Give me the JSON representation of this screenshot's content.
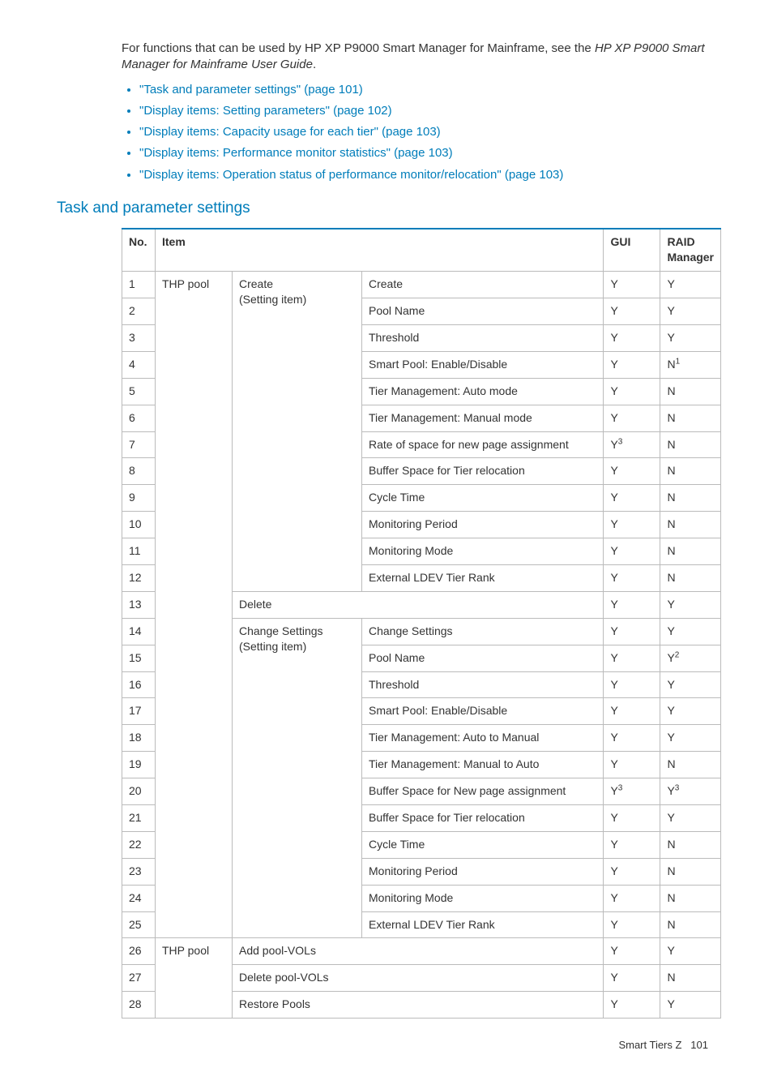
{
  "intro": {
    "text1": "For functions that can be used by HP XP P9000 Smart Manager for Mainframe, see the ",
    "italic": "HP XP P9000 Smart Manager for Mainframe User Guide",
    "text2": "."
  },
  "toc": [
    "\"Task and parameter settings\" (page 101)",
    "\"Display items: Setting parameters\" (page 102)",
    "\"Display items: Capacity usage for each tier\" (page 103)",
    "\"Display items: Performance monitor statistics\" (page 103)",
    "\"Display items: Operation status of performance monitor/relocation\" (page 103)"
  ],
  "section_heading": "Task and parameter settings",
  "table": {
    "headers": {
      "no": "No.",
      "item": "Item",
      "gui": "GUI",
      "raid": "RAID Manager"
    },
    "rows": [
      {
        "no": "1",
        "item1": "THP pool",
        "item2": "Create",
        "item2b": "(Setting item)",
        "item3": "Create",
        "gui": "Y",
        "gui_sup": "",
        "raid": "Y",
        "raid_sup": ""
      },
      {
        "no": "2",
        "item1": "",
        "item2": "",
        "item2b": "",
        "item3": "Pool Name",
        "gui": "Y",
        "gui_sup": "",
        "raid": "Y",
        "raid_sup": ""
      },
      {
        "no": "3",
        "item1": "",
        "item2": "",
        "item2b": "",
        "item3": "Threshold",
        "gui": "Y",
        "gui_sup": "",
        "raid": "Y",
        "raid_sup": ""
      },
      {
        "no": "4",
        "item1": "",
        "item2": "",
        "item2b": "",
        "item3": "Smart Pool: Enable/Disable",
        "gui": "Y",
        "gui_sup": "",
        "raid": "N",
        "raid_sup": "1"
      },
      {
        "no": "5",
        "item1": "",
        "item2": "",
        "item2b": "",
        "item3": "Tier Management: Auto mode",
        "gui": "Y",
        "gui_sup": "",
        "raid": "N",
        "raid_sup": ""
      },
      {
        "no": "6",
        "item1": "",
        "item2": "",
        "item2b": "",
        "item3": "Tier Management: Manual mode",
        "gui": "Y",
        "gui_sup": "",
        "raid": "N",
        "raid_sup": ""
      },
      {
        "no": "7",
        "item1": "",
        "item2": "",
        "item2b": "",
        "item3": "Rate of space for new page assignment",
        "gui": "Y",
        "gui_sup": "3",
        "raid": "N",
        "raid_sup": ""
      },
      {
        "no": "8",
        "item1": "",
        "item2": "",
        "item2b": "",
        "item3": "Buffer Space for Tier relocation",
        "gui": "Y",
        "gui_sup": "",
        "raid": "N",
        "raid_sup": ""
      },
      {
        "no": "9",
        "item1": "",
        "item2": "",
        "item2b": "",
        "item3": "Cycle Time",
        "gui": "Y",
        "gui_sup": "",
        "raid": "N",
        "raid_sup": ""
      },
      {
        "no": "10",
        "item1": "",
        "item2": "",
        "item2b": "",
        "item3": "Monitoring Period",
        "gui": "Y",
        "gui_sup": "",
        "raid": "N",
        "raid_sup": ""
      },
      {
        "no": "11",
        "item1": "",
        "item2": "",
        "item2b": "",
        "item3": "Monitoring Mode",
        "gui": "Y",
        "gui_sup": "",
        "raid": "N",
        "raid_sup": ""
      },
      {
        "no": "12",
        "item1": "",
        "item2": "",
        "item2b": "",
        "item3": "External LDEV Tier Rank",
        "gui": "Y",
        "gui_sup": "",
        "raid": "N",
        "raid_sup": ""
      },
      {
        "no": "13",
        "item1": "",
        "item2": "Delete",
        "item2b": "",
        "item3": "",
        "gui": "Y",
        "gui_sup": "",
        "raid": "Y",
        "raid_sup": ""
      },
      {
        "no": "14",
        "item1": "",
        "item2": "Change Settings",
        "item2b": "(Setting item)",
        "item3": "Change Settings",
        "gui": "Y",
        "gui_sup": "",
        "raid": "Y",
        "raid_sup": ""
      },
      {
        "no": "15",
        "item1": "",
        "item2": "",
        "item2b": "",
        "item3": "Pool Name",
        "gui": "Y",
        "gui_sup": "",
        "raid": "Y",
        "raid_sup": "2"
      },
      {
        "no": "16",
        "item1": "",
        "item2": "",
        "item2b": "",
        "item3": "Threshold",
        "gui": "Y",
        "gui_sup": "",
        "raid": "Y",
        "raid_sup": ""
      },
      {
        "no": "17",
        "item1": "",
        "item2": "",
        "item2b": "",
        "item3": "Smart Pool: Enable/Disable",
        "gui": "Y",
        "gui_sup": "",
        "raid": "Y",
        "raid_sup": ""
      },
      {
        "no": "18",
        "item1": "",
        "item2": "",
        "item2b": "",
        "item3": "Tier Management: Auto to Manual",
        "gui": "Y",
        "gui_sup": "",
        "raid": "Y",
        "raid_sup": ""
      },
      {
        "no": "19",
        "item1": "",
        "item2": "",
        "item2b": "",
        "item3": "Tier Management: Manual to Auto",
        "gui": "Y",
        "gui_sup": "",
        "raid": "N",
        "raid_sup": ""
      },
      {
        "no": "20",
        "item1": "",
        "item2": "",
        "item2b": "",
        "item3": "Buffer Space for New page assignment",
        "gui": "Y",
        "gui_sup": "3",
        "raid": "Y",
        "raid_sup": "3"
      },
      {
        "no": "21",
        "item1": "",
        "item2": "",
        "item2b": "",
        "item3": "Buffer Space for Tier relocation",
        "gui": "Y",
        "gui_sup": "",
        "raid": "Y",
        "raid_sup": ""
      },
      {
        "no": "22",
        "item1": "",
        "item2": "",
        "item2b": "",
        "item3": "Cycle Time",
        "gui": "Y",
        "gui_sup": "",
        "raid": "N",
        "raid_sup": ""
      },
      {
        "no": "23",
        "item1": "",
        "item2": "",
        "item2b": "",
        "item3": "Monitoring Period",
        "gui": "Y",
        "gui_sup": "",
        "raid": "N",
        "raid_sup": ""
      },
      {
        "no": "24",
        "item1": "",
        "item2": "",
        "item2b": "",
        "item3": "Monitoring Mode",
        "gui": "Y",
        "gui_sup": "",
        "raid": "N",
        "raid_sup": ""
      },
      {
        "no": "25",
        "item1": "",
        "item2": "",
        "item2b": "",
        "item3": "External LDEV Tier Rank",
        "gui": "Y",
        "gui_sup": "",
        "raid": "N",
        "raid_sup": ""
      },
      {
        "no": "26",
        "item1": "THP pool",
        "item2": "Add pool-VOLs",
        "item2b": "",
        "item3": "",
        "gui": "Y",
        "gui_sup": "",
        "raid": "Y",
        "raid_sup": ""
      },
      {
        "no": "27",
        "item1": "",
        "item2": "Delete pool-VOLs",
        "item2b": "",
        "item3": "",
        "gui": "Y",
        "gui_sup": "",
        "raid": "N",
        "raid_sup": ""
      },
      {
        "no": "28",
        "item1": "",
        "item2": "Restore Pools",
        "item2b": "",
        "item3": "",
        "gui": "Y",
        "gui_sup": "",
        "raid": "Y",
        "raid_sup": ""
      }
    ]
  },
  "footer": {
    "label": "Smart Tiers Z",
    "page": "101"
  }
}
